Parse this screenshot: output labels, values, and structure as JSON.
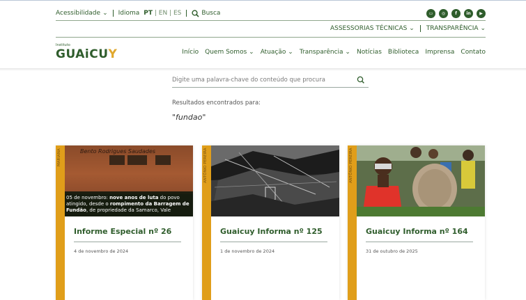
{
  "utility": {
    "accessibility": "Acessibilidade",
    "language_label": "Idioma",
    "lang_pt": "PT",
    "lang_en": "EN",
    "lang_es": "ES",
    "search_label": "Busca",
    "social": [
      "message-icon",
      "instagram-icon",
      "facebook-icon",
      "linkedin-icon",
      "youtube-icon"
    ]
  },
  "subnav": {
    "tech": "ASSESSORIAS TÉCNICAS",
    "transparency": "TRANSPARÊNCIA"
  },
  "logo": {
    "small": "Instituto",
    "main": "GUAiCU",
    "y": "Y"
  },
  "nav": {
    "items": [
      "Início",
      "Quem Somos",
      "Atuação",
      "Transparência",
      "Notícias",
      "Biblioteca",
      "Imprensa",
      "Contato"
    ]
  },
  "search": {
    "placeholder": "Digite uma palavra-chave do conteúdo que procura"
  },
  "results": {
    "label": "Resultados encontrados para:",
    "query": "\"fundao\""
  },
  "cards": [
    {
      "vertical": "MARIANA",
      "title": "Informe Especial nº 26",
      "date": "4 de novembro de 2024",
      "handwriting": "Bento Rodrigues Saudades",
      "caption_pre": "05 de novembro: ",
      "caption_b1": "nove anos de luta",
      "caption_mid": " do povo atingido, desde o ",
      "caption_b2": "rompimento da Barragem de Fundão",
      "caption_post": ", de propriedade da Samarco, Vale"
    },
    {
      "vertical": "ANTÔNIO PEREIRA",
      "title": "Guaicuy Informa nº 125",
      "date": "1 de novembro de 2024"
    },
    {
      "vertical": "ANTÔNIO PEREIRA",
      "title": "Guaicuy Informa nº 164",
      "date": "31 de outubro de 2025"
    }
  ],
  "colors": {
    "brand_green": "#2f5d2c",
    "accent_orange": "#e09e1a"
  }
}
